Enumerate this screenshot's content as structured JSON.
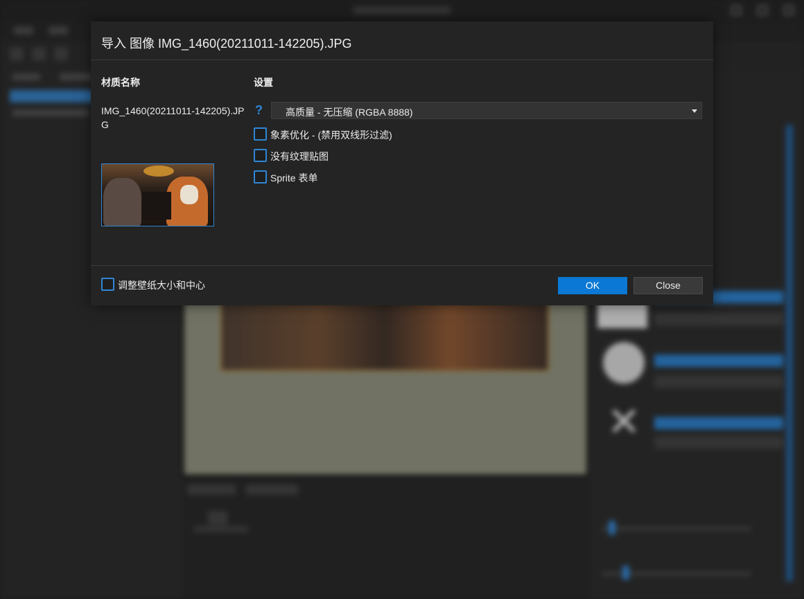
{
  "dialog": {
    "title": "导入 图像 IMG_1460(20211011-142205).JPG",
    "material_heading": "材质名称",
    "settings_heading": "设置",
    "material_name": "IMG_1460(20211011-142205).JPG",
    "help_icon": "?",
    "quality_select": {
      "value": "高质量 - 无压缩 (RGBA 8888)"
    },
    "options": [
      {
        "label": "象素优化 - (禁用双线形过滤)",
        "checked": false
      },
      {
        "label": "没有纹理贴图",
        "checked": false
      },
      {
        "label": "Sprite 表单",
        "checked": false
      }
    ],
    "footer_option": {
      "label": "调整壁纸大小和中心",
      "checked": false
    },
    "ok_label": "OK",
    "close_label": "Close"
  },
  "icons": {
    "help": "question-mark-icon",
    "dropdown": "chevron-down-icon"
  },
  "colors": {
    "accent": "#2f86d6",
    "ok_button": "#0a78d4",
    "dialog_bg": "#242424"
  }
}
